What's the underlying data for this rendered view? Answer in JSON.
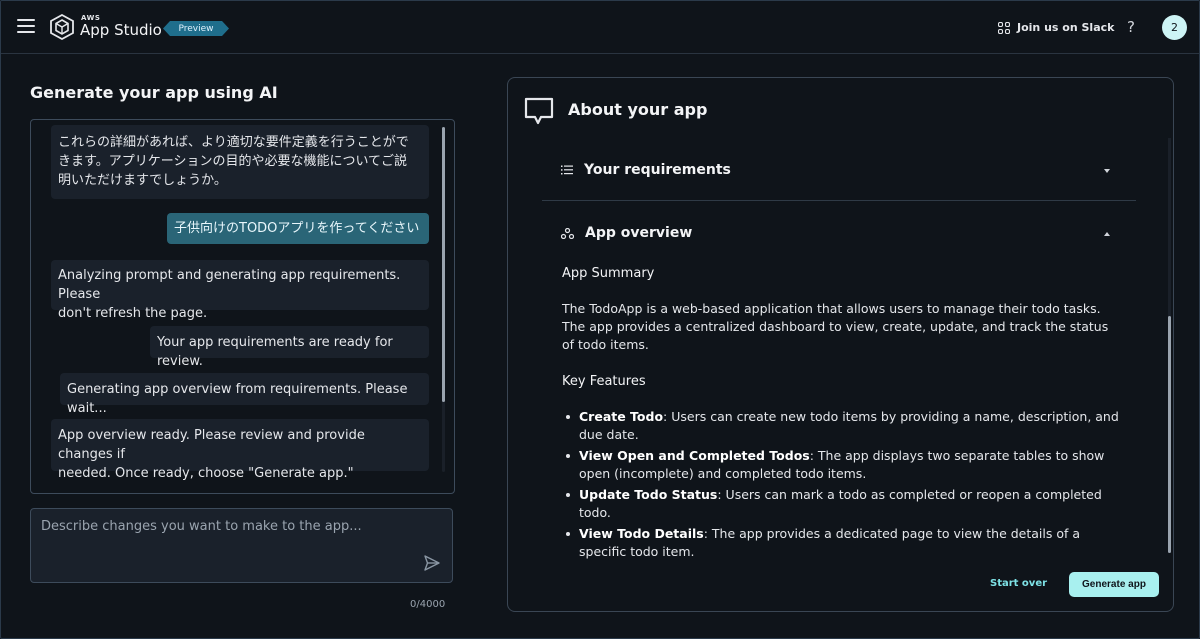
{
  "header": {
    "brand_small": "AWS",
    "brand": "App Studio",
    "badge": "Preview",
    "slack_link": "Join us on Slack",
    "help": "?",
    "avatar": "2"
  },
  "left": {
    "title": "Generate your app using AI",
    "messages": [
      {
        "role": "ai",
        "lines": [
          "これらの詳細があれば、より適切な要件定義を行うことがで",
          "きます。アプリケーションの目的や必要な機能についてご説",
          "明いただけますでしょうか。"
        ]
      },
      {
        "role": "user",
        "lines": [
          "子供向けのTODOアプリを作ってください"
        ]
      },
      {
        "role": "ai",
        "lines": [
          "Analyzing prompt and generating app requirements. Please",
          "don't refresh the page."
        ]
      },
      {
        "role": "ai",
        "lines": [
          "Your app requirements are ready for review."
        ]
      },
      {
        "role": "ai",
        "lines": [
          "Generating app overview from requirements. Please wait..."
        ]
      },
      {
        "role": "ai",
        "lines": [
          "App overview ready. Please review and provide changes if",
          "needed. Once ready, choose \"Generate app.\""
        ]
      }
    ],
    "input_placeholder": "Describe changes you want to make to the app...",
    "counter": "0/4000"
  },
  "right": {
    "title": "About your app",
    "requirements_label": "Your requirements",
    "overview_label": "App overview",
    "summary_heading": "App Summary",
    "summary_text": "The TodoApp is a web-based application that allows users to manage their todo tasks. The app provides a centralized dashboard to view, create, update, and track the status of todo items.",
    "features_heading": "Key Features",
    "features": [
      {
        "name": "Create Todo",
        "desc": ": Users can create new todo items by providing a name, description, and due date."
      },
      {
        "name": "View Open and Completed Todos",
        "desc": ": The app displays two separate tables to show open (incomplete) and completed todo items."
      },
      {
        "name": "Update Todo Status",
        "desc": ": Users can mark a todo as completed or reopen a completed todo."
      },
      {
        "name": "View Todo Details",
        "desc": ": The app provides a dedicated page to view the details of a specific todo item."
      }
    ],
    "start_over": "Start over",
    "generate": "Generate app"
  },
  "colors": {
    "accent": "#a8f0ef",
    "badge": "#1f6e8c",
    "user_bubble": "#2a6577",
    "background": "#0f141a"
  },
  "icons": [
    "menu-icon",
    "app-studio-logo-icon",
    "slack-icon",
    "help-icon",
    "chat-bubble-icon",
    "list-icon",
    "overview-icon",
    "send-icon"
  ]
}
